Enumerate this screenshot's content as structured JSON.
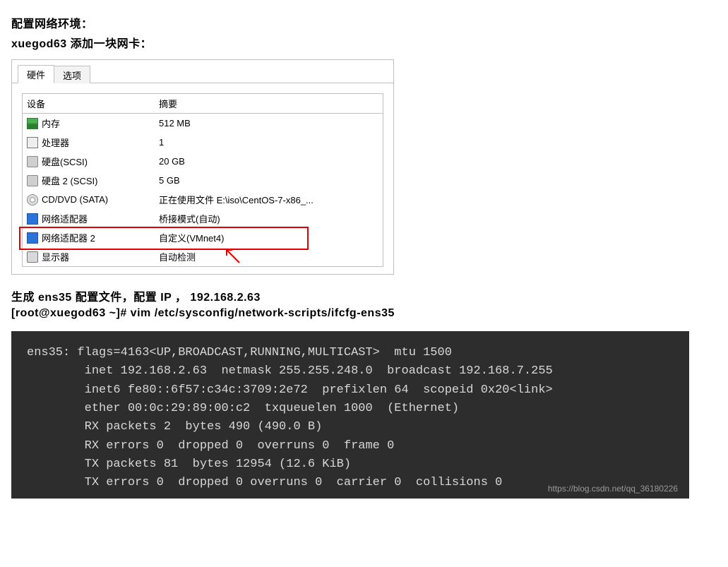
{
  "doc": {
    "line1": "配置网络环境：",
    "line2": "xuegod63  添加一块网卡：",
    "line3": "生成 ens35 配置文件，配置 IP ， 192.168.2.63",
    "line4": "[root@xuegod63 ~]# vim /etc/sysconfig/network-scripts/ifcfg-ens35"
  },
  "vm": {
    "tab_hardware": "硬件",
    "tab_options": "选项",
    "col_device": "设备",
    "col_summary": "摘要",
    "rows": [
      {
        "icon": "mem",
        "device": "内存",
        "summary": "512 MB"
      },
      {
        "icon": "cpu",
        "device": "处理器",
        "summary": "1"
      },
      {
        "icon": "hdd",
        "device": "硬盘(SCSI)",
        "summary": "20 GB"
      },
      {
        "icon": "hdd",
        "device": "硬盘 2 (SCSI)",
        "summary": "5 GB"
      },
      {
        "icon": "cd",
        "device": "CD/DVD (SATA)",
        "summary": "正在使用文件 E:\\iso\\CentOS-7-x86_..."
      },
      {
        "icon": "nic",
        "device": "网络适配器",
        "summary": "桥接模式(自动)"
      },
      {
        "icon": "nic",
        "device": "网络适配器 2",
        "summary": "自定义(VMnet4)"
      },
      {
        "icon": "disp",
        "device": "显示器",
        "summary": "自动检测"
      }
    ],
    "highlight_index": 6
  },
  "terminal": {
    "text": "ens35: flags=4163<UP,BROADCAST,RUNNING,MULTICAST>  mtu 1500\n        inet 192.168.2.63  netmask 255.255.248.0  broadcast 192.168.7.255\n        inet6 fe80::6f57:c34c:3709:2e72  prefixlen 64  scopeid 0x20<link>\n        ether 00:0c:29:89:00:c2  txqueuelen 1000  (Ethernet)\n        RX packets 2  bytes 490 (490.0 B)\n        RX errors 0  dropped 0  overruns 0  frame 0\n        TX packets 81  bytes 12954 (12.6 KiB)\n        TX errors 0  dropped 0 overruns 0  carrier 0  collisions 0"
  },
  "watermark": "https://blog.csdn.net/qq_36180226"
}
